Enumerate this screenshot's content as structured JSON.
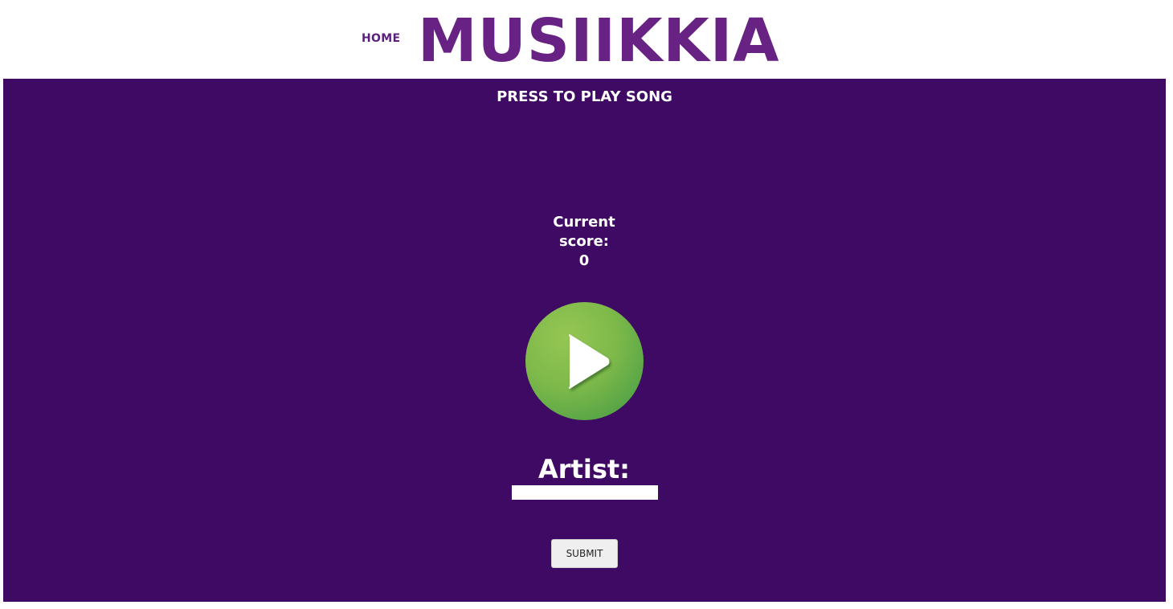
{
  "header": {
    "nav_home": "HOME",
    "logo": "MUSIIKKIA"
  },
  "game": {
    "prompt": "PRESS TO PLAY SONG",
    "score_label_line1": "Current",
    "score_label_line2": "score:",
    "score_value": "0",
    "play_button_icon": "play-icon",
    "artist_label": "Artist:",
    "artist_input_value": "",
    "submit_label": "SUBMIT"
  },
  "colors": {
    "brand_purple": "#682283",
    "stage_background": "#3f0a63",
    "play_green": "#7db94a"
  }
}
